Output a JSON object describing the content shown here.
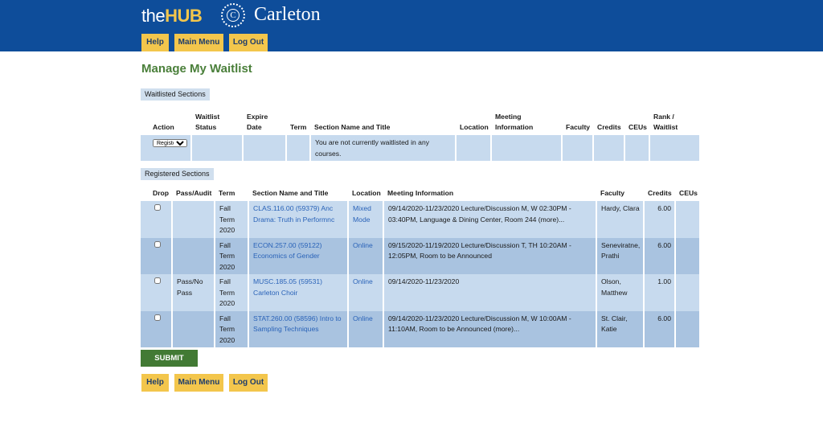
{
  "brand": {
    "the": "the",
    "hub": "HUB",
    "seal_letter": "C",
    "institution": "Carleton"
  },
  "nav": {
    "help": "Help",
    "main_menu": "Main Menu",
    "log_out": "Log Out"
  },
  "page_title": "Manage My Waitlist",
  "waitlist": {
    "tab_label": "Waitlisted Sections",
    "headers": [
      "Action",
      "Waitlist Status",
      "Expire Date",
      "Term",
      "Section Name and Title",
      "Location",
      "Meeting Information",
      "Faculty",
      "Credits",
      "CEUs",
      "Rank / Waitlist"
    ],
    "action_selected": "Register",
    "empty_message": "You are not currently waitlisted in any courses."
  },
  "registered": {
    "tab_label": "Registered Sections",
    "headers": [
      "Drop",
      "Pass/Audit",
      "Term",
      "Section Name and Title",
      "Location",
      "Meeting Information",
      "Faculty",
      "Credits",
      "CEUs"
    ],
    "rows": [
      {
        "pass_audit": "",
        "term": "Fall Term 2020",
        "section": "CLAS.116.00 (59379) Anc Drama: Truth in Performnc",
        "location": "Mixed Mode",
        "meeting": "09/14/2020-11/23/2020 Lecture/Discussion M, W 02:30PM - 03:40PM, Language & Dining Center, Room 244 (more)...",
        "faculty": "Hardy, Clara",
        "credits": "6.00",
        "ceus": ""
      },
      {
        "pass_audit": "",
        "term": "Fall Term 2020",
        "section": "ECON.257.00 (59122) Economics of Gender",
        "location": "Online",
        "meeting": "09/15/2020-11/19/2020 Lecture/Discussion T, TH 10:20AM - 12:05PM, Room to be Announced",
        "faculty": "Seneviratne, Prathi",
        "credits": "6.00",
        "ceus": ""
      },
      {
        "pass_audit": "Pass/No Pass",
        "term": "Fall Term 2020",
        "section": "MUSC.185.05 (59531) Carleton Choir",
        "location": "Online",
        "meeting": "09/14/2020-11/23/2020",
        "faculty": "Olson, Matthew",
        "credits": "1.00",
        "ceus": ""
      },
      {
        "pass_audit": "",
        "term": "Fall Term 2020",
        "section": "STAT.260.00 (58596) Intro to Sampling Techniques",
        "location": "Online",
        "meeting": "09/14/2020-11/23/2020 Lecture/Discussion M, W 10:00AM - 11:10AM, Room to be Announced (more)...",
        "faculty": "St. Clair, Katie",
        "credits": "6.00",
        "ceus": ""
      }
    ]
  },
  "submit_label": "SUBMIT",
  "colors": {
    "header_blue": "#0e4d9a",
    "nav_gold": "#f3c64c",
    "title_green": "#4a7f3a",
    "submit_green": "#427a34",
    "row_light": "#c7daee",
    "row_dark": "#a9c3e0",
    "link_blue": "#2a63b8"
  }
}
